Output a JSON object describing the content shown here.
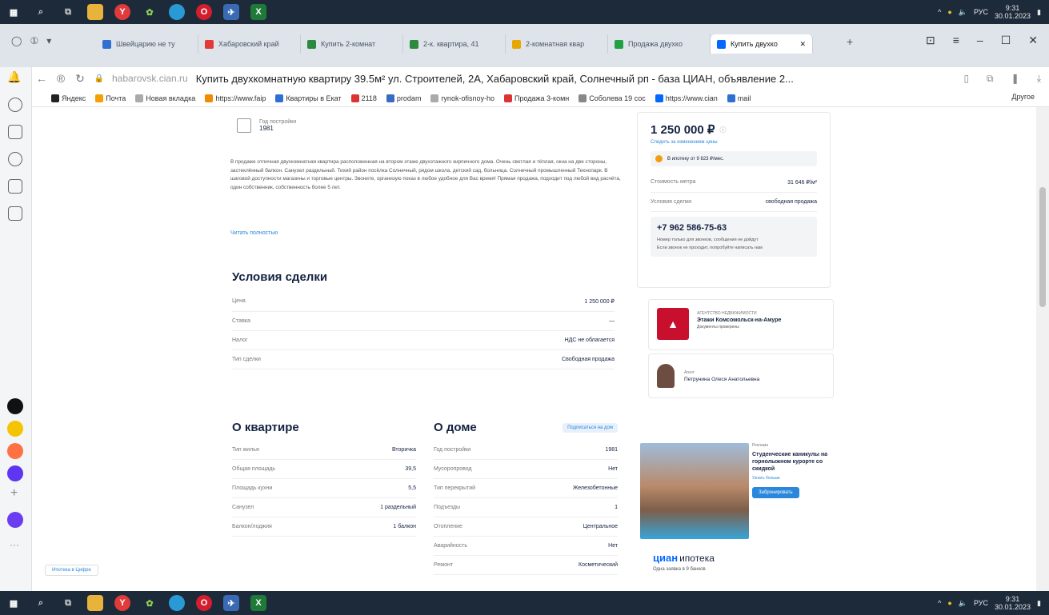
{
  "taskbar": {
    "lang": "РУС",
    "time": "9:31",
    "date": "30.01.2023"
  },
  "tabs": [
    {
      "label": "Швейцарию не ту",
      "color": "#2f6fd1"
    },
    {
      "label": "Хабаровский край",
      "color": "#e03a3a"
    },
    {
      "label": "Купить 2-комнат",
      "color": "#2b8a3e"
    },
    {
      "label": "2-к. квартира, 41",
      "color": "#2b8a3e"
    },
    {
      "label": "2-комнатная квар",
      "color": "#e6a800"
    },
    {
      "label": "Продажа двухко",
      "color": "#22a043"
    },
    {
      "label": "Купить двухко",
      "color": "#0468ff",
      "active": true
    }
  ],
  "address": {
    "domain": "habarovsk.cian.ru",
    "title": "Купить двухкомнатную квартиру 39.5м² ул. Строителей, 2А, Хабаровский край, Солнечный рп - база ЦИАН, объявление 2..."
  },
  "bookmarks": [
    {
      "label": "Яндекс",
      "color": "#222"
    },
    {
      "label": "Почта",
      "color": "#f5a000"
    },
    {
      "label": "Новая вкладка",
      "color": "#aaa"
    },
    {
      "label": "https://www.faip",
      "color": "#f08a00"
    },
    {
      "label": "Квартиры в Екат",
      "color": "#2f6fd1"
    },
    {
      "label": "2118",
      "color": "#d33"
    },
    {
      "label": "prodam",
      "color": "#3a6bc4"
    },
    {
      "label": "rynok-ofisnoy-ho",
      "color": "#aaa"
    },
    {
      "label": "Продажа 3-комн",
      "color": "#d33"
    },
    {
      "label": "Соболева 19 сос",
      "color": "#888"
    },
    {
      "label": "https://www.cian",
      "color": "#0468ff"
    },
    {
      "label": "mail",
      "color": "#2f6fd1"
    }
  ],
  "bookmarks_other": "Другое",
  "listing": {
    "year_label": "Год постройки",
    "year_value": "1981",
    "description": "В продаже отличная двухкомнатная квартира расположенная на втором этаже двухэтажного кирпичного дома. Очень светлая и тёплая, окна на две стороны, застеклённый балкон. Санузел раздельный. Тихий район посёлка Солнечный, рядом школа, детский сад, больница. Солнечный промышленный Технопарк. В шаговой доступности магазины и торговые центры. Звоните, организую показ в любое удобное для Вас время! Прямая продажа, подходит под любой вид расчёта, один собственник, собственность более 5 лет.",
    "show_more": "Читать полностью"
  },
  "deal": {
    "title": "Условия сделки",
    "rows": [
      {
        "label": "Цена",
        "value": "1 250 000 ₽"
      },
      {
        "label": "Ставка",
        "value": "—"
      },
      {
        "label": "Налог",
        "value": "НДС не облагается"
      },
      {
        "label": "Тип сделки",
        "value": "Свободная продажа"
      }
    ]
  },
  "flat": {
    "title": "О квартире",
    "rows": [
      {
        "label": "Тип жилья",
        "value": "Вторичка"
      },
      {
        "label": "Общая площадь",
        "value": "39,5"
      },
      {
        "label": "Площадь кухни",
        "value": "5,5"
      },
      {
        "label": "Санузел",
        "value": "1 раздельный"
      },
      {
        "label": "Балкон/лоджия",
        "value": "1 балкон"
      }
    ]
  },
  "house": {
    "title": "О доме",
    "badge": "Подписаться на дом",
    "rows": [
      {
        "label": "Год постройки",
        "value": "1981"
      },
      {
        "label": "Мусоропровод",
        "value": "Нет"
      },
      {
        "label": "Тип перекрытий",
        "value": "Железобетонные"
      },
      {
        "label": "Подъезды",
        "value": "1"
      },
      {
        "label": "Отопление",
        "value": "Центральное"
      },
      {
        "label": "Аварийность",
        "value": "Нет"
      },
      {
        "label": "Ремонт",
        "value": "Косметический"
      }
    ]
  },
  "price_card": {
    "price": "1 250 000 ₽",
    "subscribe": "Следить за изменением цены",
    "mortgage": "В ипотеку от 9 823 ₽/мес.",
    "rows": [
      {
        "label": "Стоимость метра",
        "value": "31 646 ₽/м²"
      },
      {
        "label": "Условия сделки",
        "value": "свободная продажа"
      }
    ],
    "phone": "+7 962 586-75-63",
    "note1": "Номер только для звонков, сообщения не дойдут",
    "note2": "Если звонок не проходит, попробуйте написать нам"
  },
  "agency": {
    "kicker": "АГЕНТСТВО НЕДВИЖИМОСТИ",
    "name": "Этажи Комсомольск-на-Амуре",
    "docs": "Документы проверены"
  },
  "agent": {
    "kicker": "Агент",
    "name": "Петрунина Олеся Анатольевна"
  },
  "ad": {
    "kicker": "Реклама",
    "title": "Студенческие каникулы на горнолыжном курорте со скидкой",
    "link": "Узнать больше",
    "button": "Забронировать"
  },
  "cian_ipoteka": {
    "brand": "циан",
    "word": "ипотека",
    "sub": "Одна заявка в 9 банков"
  },
  "footer_link": "Ипотека в Цифре"
}
